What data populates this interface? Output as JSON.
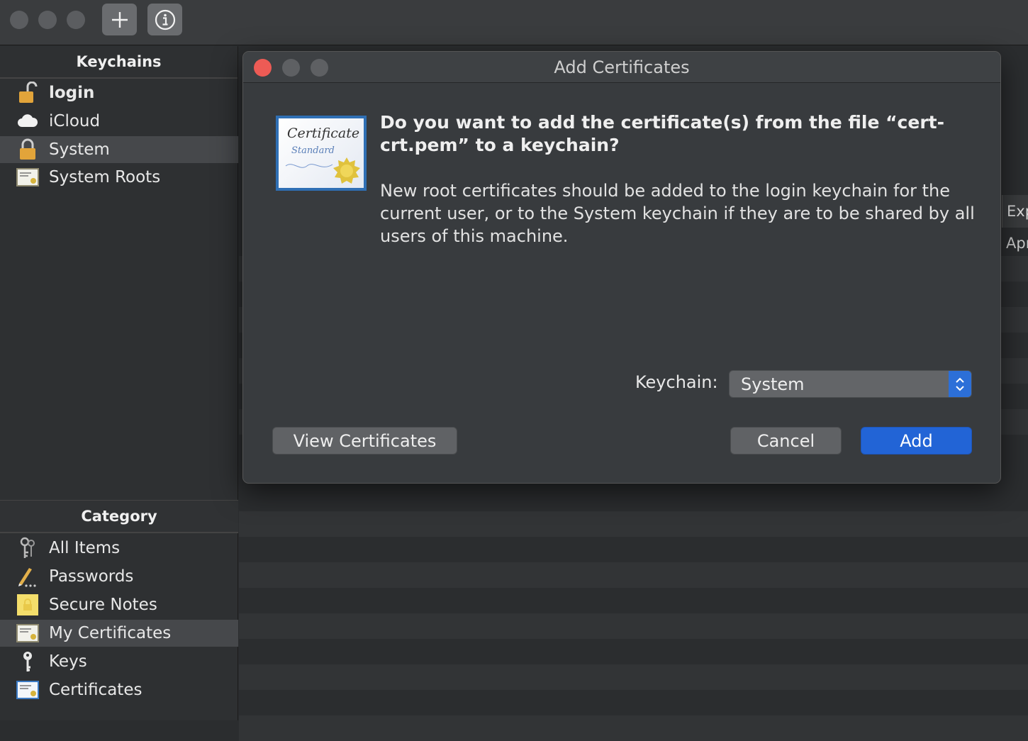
{
  "toolbar": {
    "add_icon": "plus-icon",
    "info_icon": "info-icon"
  },
  "sidebar": {
    "keychains_header": "Keychains",
    "keychains": [
      {
        "label": "login",
        "icon": "unlocked-padlock-icon",
        "bold": true
      },
      {
        "label": "iCloud",
        "icon": "cloud-icon"
      },
      {
        "label": "System",
        "icon": "padlock-icon",
        "selected": true
      },
      {
        "label": "System Roots",
        "icon": "certificate-icon"
      }
    ],
    "category_header": "Category",
    "categories": [
      {
        "label": "All Items",
        "icon": "keys-icon"
      },
      {
        "label": "Passwords",
        "icon": "pencil-icon"
      },
      {
        "label": "Secure Notes",
        "icon": "note-icon"
      },
      {
        "label": "My Certificates",
        "icon": "certificate-icon",
        "selected": true
      },
      {
        "label": "Keys",
        "icon": "key-icon"
      },
      {
        "label": "Certificates",
        "icon": "certificate-icon"
      }
    ]
  },
  "table": {
    "expires_header": "Exp",
    "first_row_expires": "Apr"
  },
  "dialog": {
    "title": "Add Certificates",
    "cert_icon_text_1": "Certificate",
    "cert_icon_text_2": "Standard",
    "heading_line1": "Do you want to add the certificate(s) from the file “cert-",
    "heading_line2": "crt.pem” to a keychain?",
    "body_line1": "New root certificates should be added to the login keychain for the",
    "body_line2": "current user, or to the System keychain if they are to be shared by all",
    "body_line3": "users of this machine.",
    "keychain_label": "Keychain:",
    "keychain_value": "System",
    "view_certificates_button": "View Certificates",
    "cancel_button": "Cancel",
    "add_button": "Add"
  },
  "colors": {
    "accent": "#2264d6",
    "close_red": "#ed5b55"
  }
}
